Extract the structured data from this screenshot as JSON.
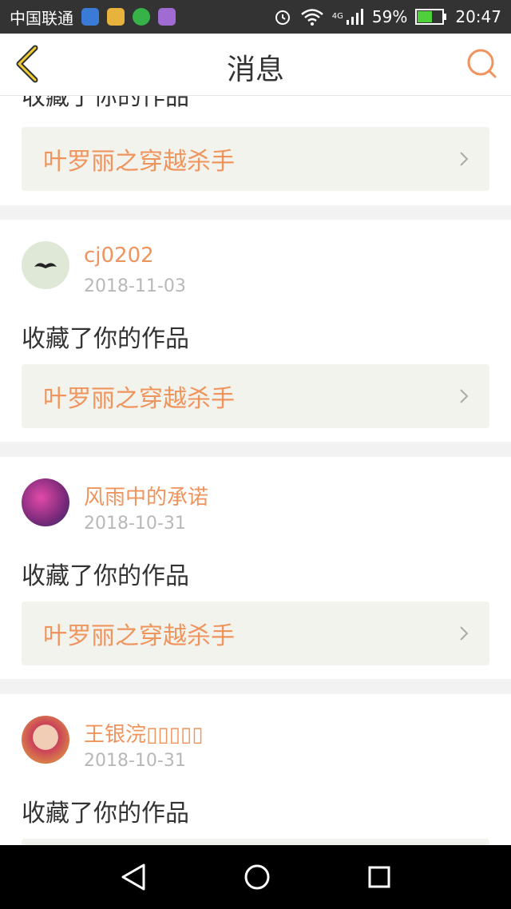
{
  "status": {
    "carrier": "中国联通",
    "network": "4G",
    "battery": "59%",
    "time": "20:47"
  },
  "header": {
    "title": "消息"
  },
  "colors": {
    "accent": "#f0945d",
    "card_bg": "#f3f3ee",
    "date": "#b8b8b8"
  },
  "messages": [
    {
      "user": "",
      "date": "",
      "action": "收藏了你的作品",
      "work": "叶罗丽之穿越杀手"
    },
    {
      "user": "cj0202",
      "date": "2018-11-03",
      "action": "收藏了你的作品",
      "work": "叶罗丽之穿越杀手"
    },
    {
      "user": "风雨中的承诺",
      "date": "2018-10-31",
      "action": "收藏了你的作品",
      "work": "叶罗丽之穿越杀手"
    },
    {
      "user": "王银浣▯▯▯▯▯",
      "date": "2018-10-31",
      "action": "收藏了你的作品",
      "work": ""
    }
  ]
}
